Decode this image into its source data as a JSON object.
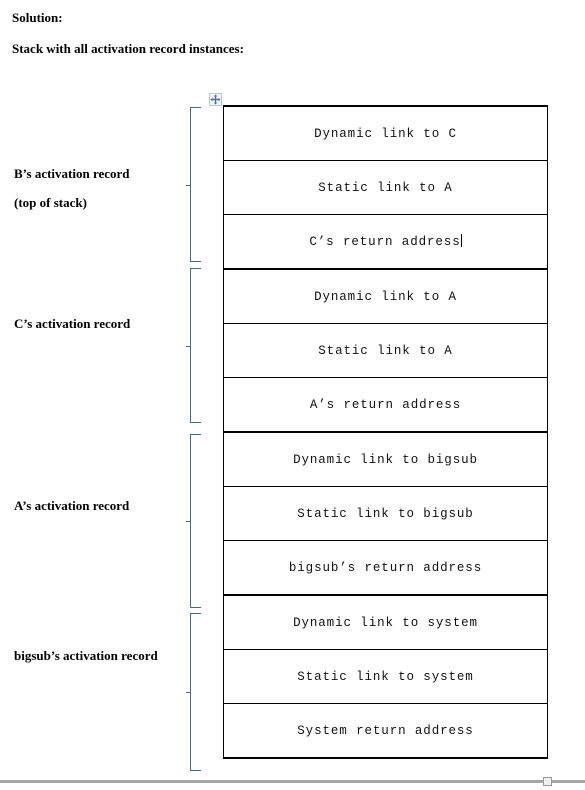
{
  "document": {
    "solution_heading": "Solution:",
    "stack_heading": "Stack with all activation record instances:"
  },
  "icons": {
    "table_move_handle": "move-cross-icon",
    "page_resize_handle": "resize-handle-icon"
  },
  "stack": {
    "groups": [
      {
        "label": "B’s activation record",
        "sublabel": "(top of stack)",
        "rows": [
          {
            "text": "Dynamic link to C",
            "caret": false
          },
          {
            "text": "Static link to A",
            "caret": false
          },
          {
            "text": "C’s return address",
            "caret": true
          }
        ]
      },
      {
        "label": "C’s activation record",
        "sublabel": "",
        "rows": [
          {
            "text": "Dynamic link to A",
            "caret": false
          },
          {
            "text": "Static link to A",
            "caret": false
          },
          {
            "text": "A’s return address",
            "caret": false
          }
        ]
      },
      {
        "label": "A’s activation record",
        "sublabel": "",
        "rows": [
          {
            "text": "Dynamic link to bigsub",
            "caret": false
          },
          {
            "text": "Static link to bigsub",
            "caret": false
          },
          {
            "text": "bigsub’s return address",
            "caret": false
          }
        ]
      },
      {
        "label": "bigsub’s activation record",
        "sublabel": "",
        "rows": [
          {
            "text": "Dynamic link to system",
            "caret": false
          },
          {
            "text": "Static link to system",
            "caret": false
          },
          {
            "text": "System return address",
            "caret": false
          }
        ]
      }
    ]
  },
  "colors": {
    "bracket": "#4a6b82",
    "table_border": "#000000",
    "handle_border": "#b9c8dc",
    "page_rule": "#a6a6a6"
  }
}
